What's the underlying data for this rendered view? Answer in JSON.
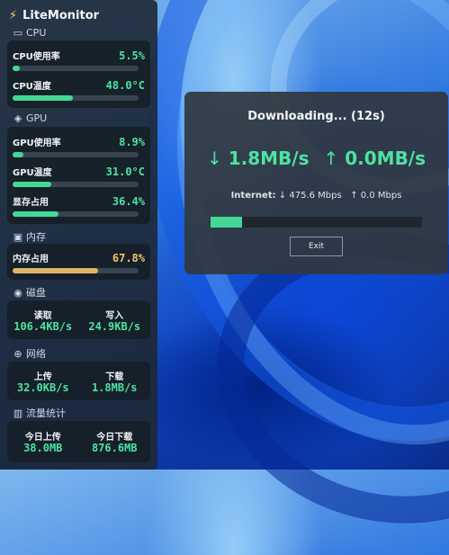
{
  "app": {
    "title": "LiteMonitor",
    "icon": "lightning-bolt-icon"
  },
  "cpu": {
    "section_title": "CPU",
    "icon": "monitor-icon",
    "usage_label": "CPU使用率",
    "usage_value": "5.5%",
    "usage_fraction": 0.055,
    "temp_label": "CPU温度",
    "temp_value": "48.0°C",
    "temp_fraction": 0.48
  },
  "gpu": {
    "section_title": "GPU",
    "icon": "gamepad-icon",
    "usage_label": "GPU使用率",
    "usage_value": "8.9%",
    "usage_fraction": 0.089,
    "temp_label": "GPU温度",
    "temp_value": "31.0°C",
    "temp_fraction": 0.31,
    "vram_label": "显存占用",
    "vram_value": "36.4%",
    "vram_fraction": 0.364
  },
  "memory": {
    "section_title": "内存",
    "icon": "memory-chip-icon",
    "usage_label": "内存占用",
    "usage_value": "67.8%",
    "usage_fraction": 0.678
  },
  "disk": {
    "section_title": "磁盘",
    "icon": "disk-icon",
    "read_label": "读取",
    "read_value": "106.4KB/s",
    "write_label": "写入",
    "write_value": "24.9KB/s"
  },
  "network": {
    "section_title": "网络",
    "icon": "globe-icon",
    "up_label": "上传",
    "up_value": "32.0KB/s",
    "down_label": "下载",
    "down_value": "1.8MB/s"
  },
  "traffic": {
    "section_title": "流量统计",
    "icon": "bar-chart-icon",
    "today_up_label": "今日上传",
    "today_up_value": "38.0MB",
    "today_down_label": "今日下载",
    "today_down_value": "876.6MB"
  },
  "dialog": {
    "title": "Downloading... (12s)",
    "down_arrow": "↓",
    "down_speed": "1.8MB/s",
    "up_arrow": "↑",
    "up_speed": "0.0MB/s",
    "internet_label": "Internet:",
    "internet_down": "↓ 475.6 Mbps",
    "internet_up": "↑ 0.0 Mbps",
    "progress_fraction": 0.15,
    "exit_label": "Exit"
  },
  "colors": {
    "accent_green": "#44d894",
    "warn_gold": "#dcb565",
    "panel_bg": "#1e2834"
  }
}
